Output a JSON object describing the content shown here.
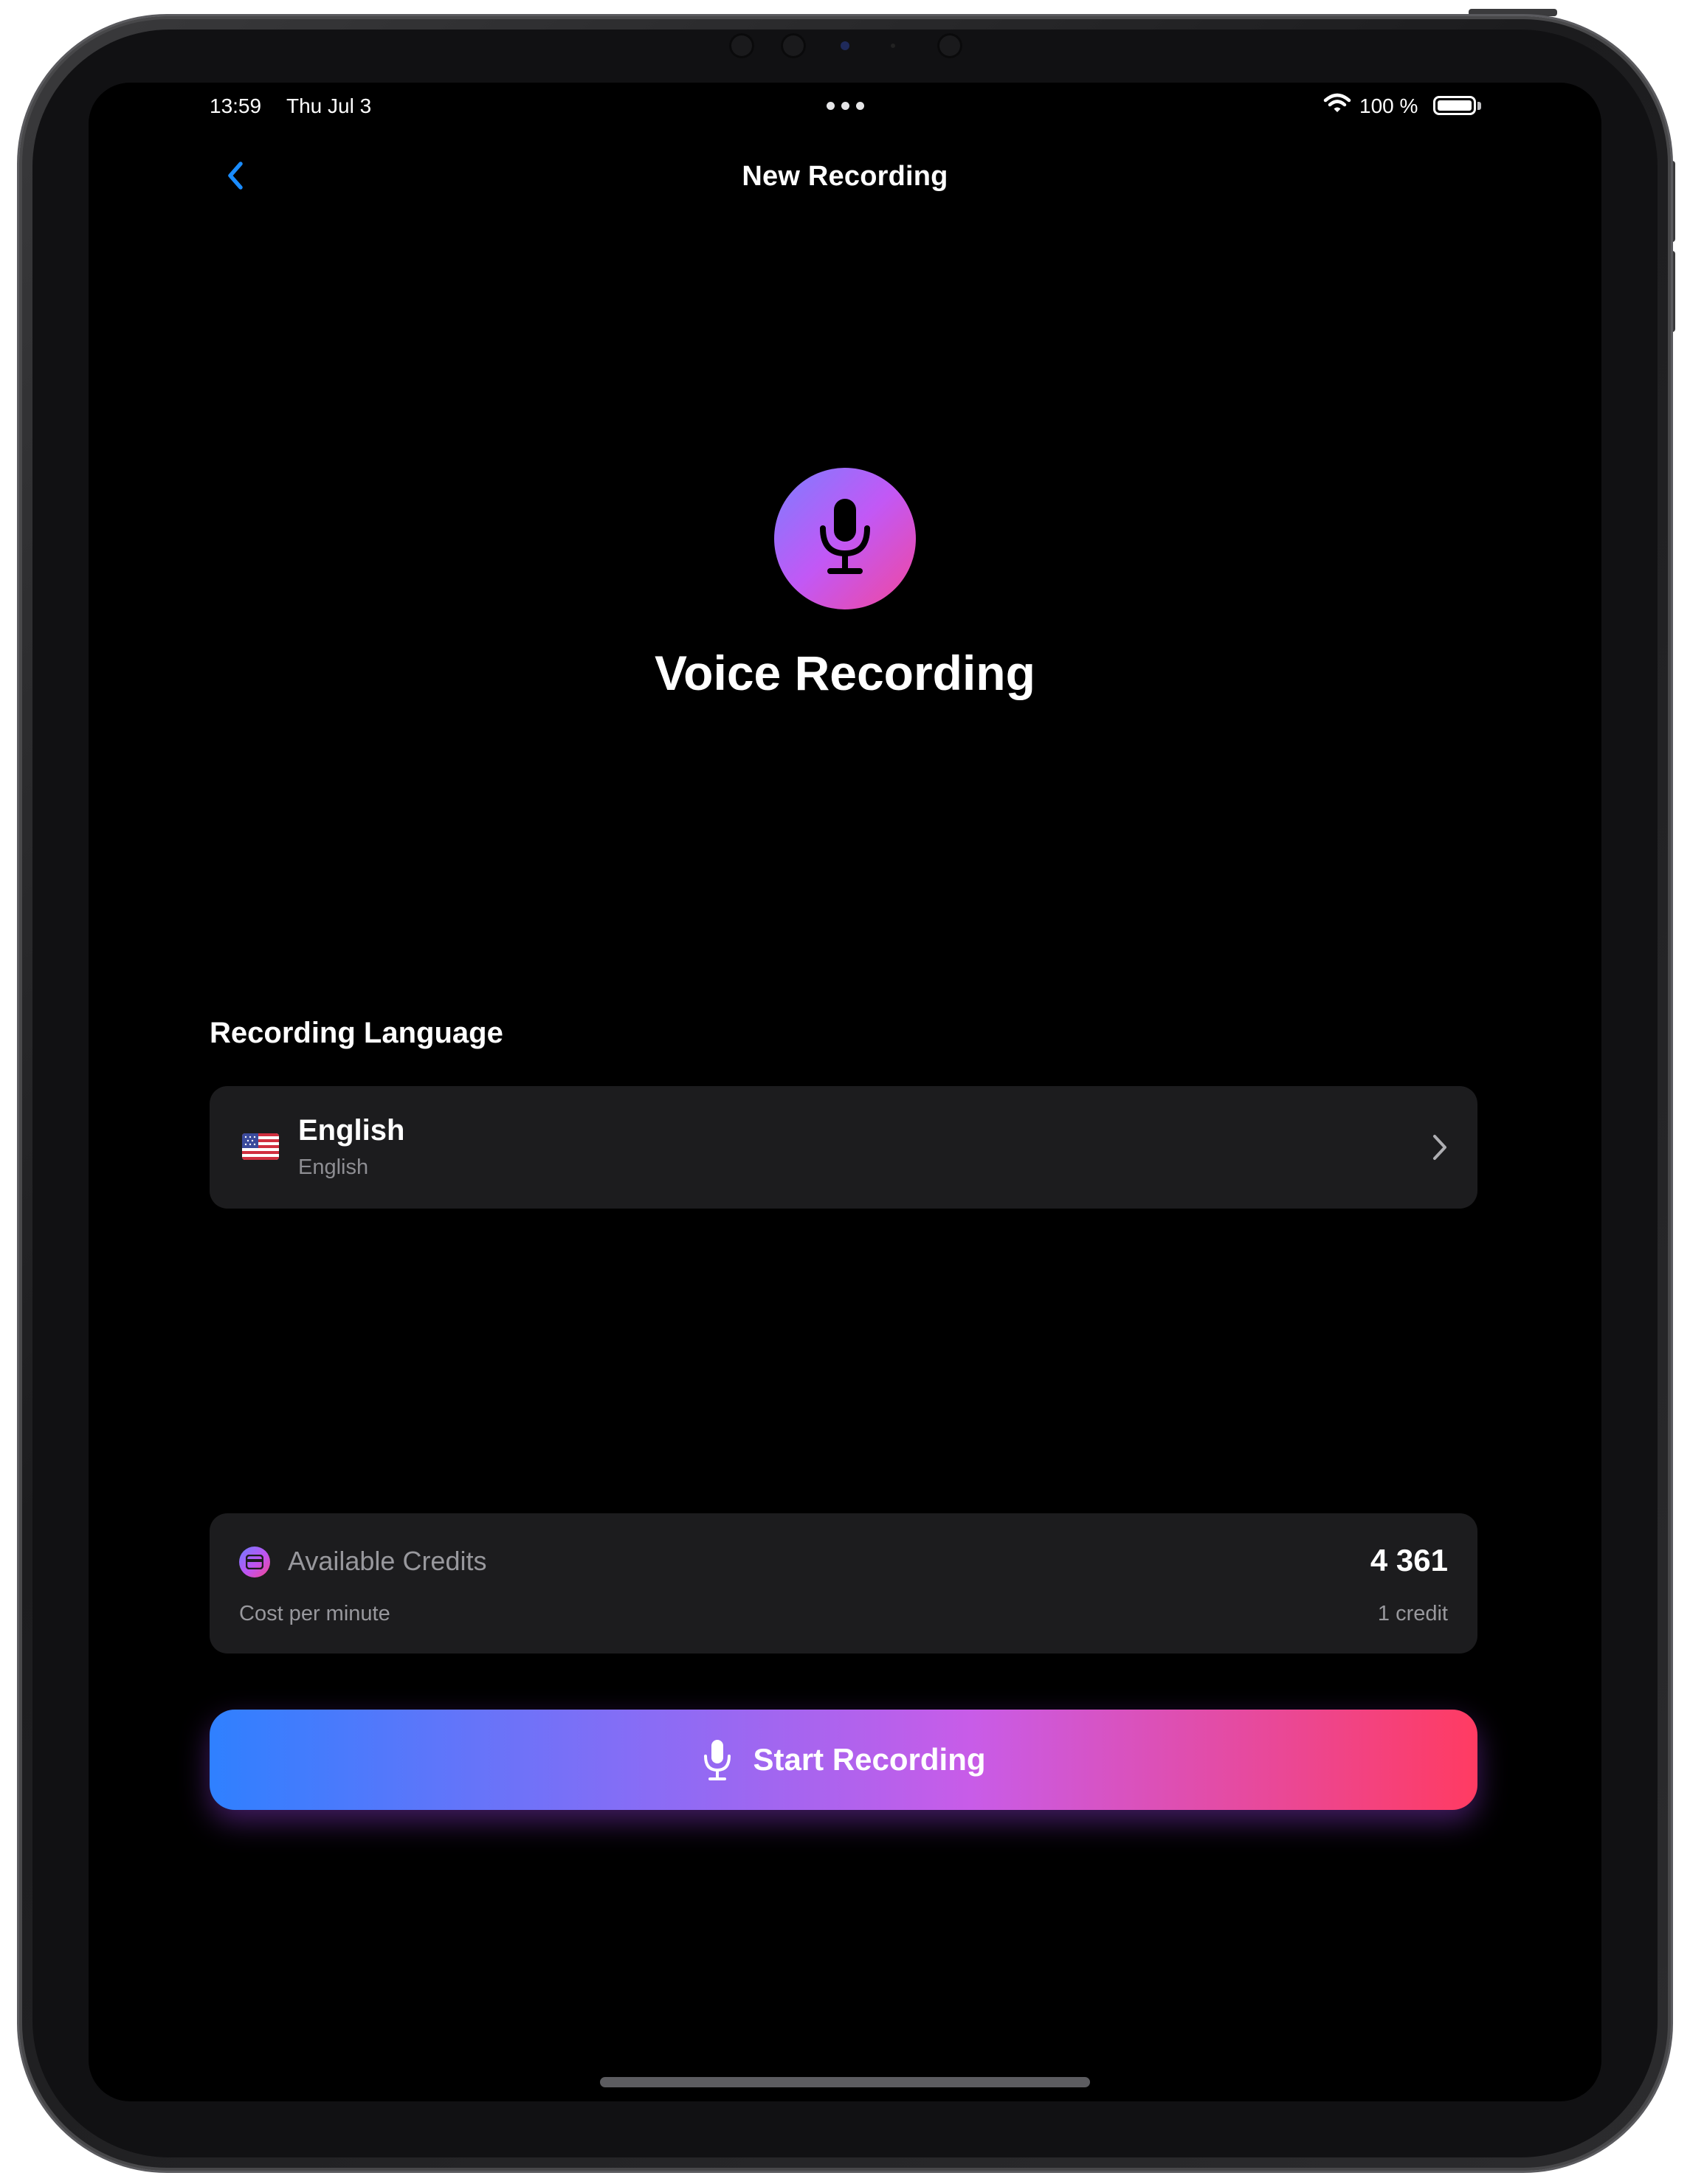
{
  "status_bar": {
    "time": "13:59",
    "date": "Thu Jul 3",
    "battery": "100 %"
  },
  "nav": {
    "title": "New Recording",
    "back_icon": "chevron-left-icon",
    "accent_color": "#1a8cff"
  },
  "hero": {
    "icon": "microphone-icon",
    "title": "Voice Recording"
  },
  "language": {
    "section_label": "Recording Language",
    "name": "English",
    "subtitle": "English",
    "flag_icon": "us-flag-icon"
  },
  "credits": {
    "label": "Available Credits",
    "value": "4 361",
    "cost_label": "Cost per minute",
    "cost_value": "1 credit"
  },
  "start_button": {
    "label": "Start Recording",
    "gradient": [
      "#2f80ff",
      "#c85ce8",
      "#ff3b62"
    ]
  }
}
